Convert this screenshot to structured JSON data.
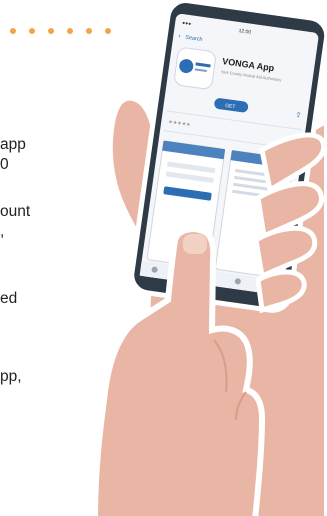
{
  "colors": {
    "dots": "#F2A54A",
    "skin": "#E9B6A5",
    "skin_shadow": "#D89D8A",
    "phone_body": "#2E3A45",
    "screen_bg": "#F4F6F9",
    "accent_blue": "#2D6DB4"
  },
  "decoration": {
    "dot_count": 6
  },
  "text_fragments": [
    "app",
    "0",
    "ount",
    ",",
    "ed",
    "pp,"
  ],
  "phone": {
    "status_time": "12:00",
    "back_label": "Search",
    "app_name": "VONGA App",
    "app_subtitle": "York County Mutual Aid Authorities",
    "get_button": "GET"
  },
  "icons": [
    "back-chevron-icon",
    "share-icon",
    "app-logo-icon"
  ]
}
